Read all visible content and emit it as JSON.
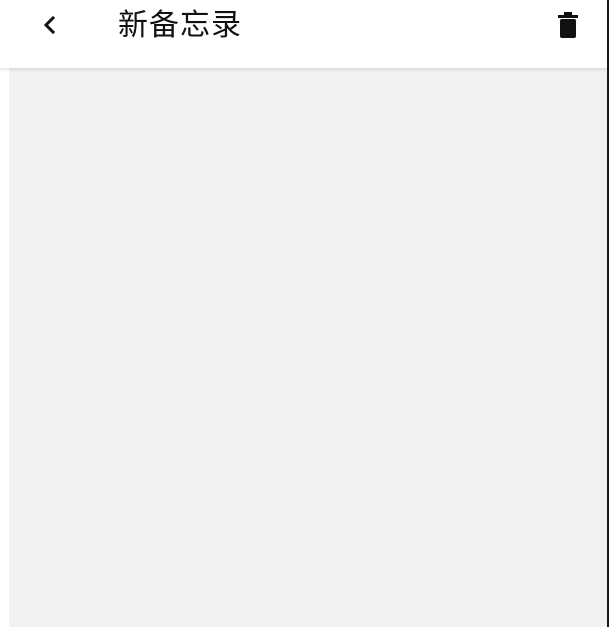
{
  "header": {
    "title": "新备忘录",
    "back_icon": "chevron-left-icon",
    "delete_icon": "trash-icon"
  },
  "colors": {
    "content_background": "#f2f2f2",
    "header_background": "#ffffff",
    "icon_color": "#111111"
  }
}
